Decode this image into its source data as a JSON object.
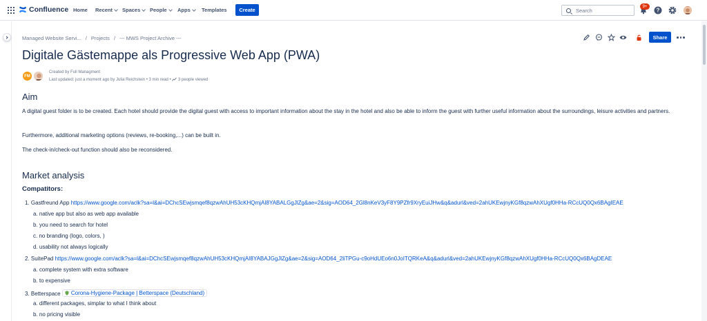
{
  "nav": {
    "logo": "Confluence",
    "home": "Home",
    "recent": "Recent",
    "spaces": "Spaces",
    "people": "People",
    "apps": "Apps",
    "templates": "Templates",
    "create": "Create",
    "search_placeholder": "Search",
    "notification_count": "9+"
  },
  "breadcrumb": [
    "Managed Website Servi...",
    "Projects",
    "--- MWS Project Archive ---"
  ],
  "page_actions": {
    "share": "Share"
  },
  "title": "Digitale Gästemappe als Progressive Web App (PWA)",
  "byline": {
    "initials": "FM",
    "created": "Created by Full Managment",
    "updated": "Last updated: just a moment ago by Julia Reichstein",
    "read_time": "3 min read",
    "viewed": "3 people viewed"
  },
  "content": {
    "aim_heading": "Aim",
    "aim_p1": "A digital guest folder is to be created. Each hotel should provide the digital guest with access to important information about the stay in the hotel and also be able to inform the guest with further useful information about the surroundings, leisure activities and partners.",
    "aim_p2": "Furthermore, additional marketing options (reviews, re-booking,...) can be built in.",
    "aim_p3": "The check-in/check-out function should also be reconsidered.",
    "market_heading": "Market analysis",
    "competitors_heading": "Compatitors:",
    "items": [
      {
        "num": "1.",
        "name": "Gastfreund App",
        "link": "https://www.google.com/aclk?sa=l&ai=DChcSEwjsmqef8qzwAhUH53cKHQmjAI8YABALGgJlZg&ae=2&sig=AOD64_2Gl8nKeV3yF8Y9PZfr9XryEuiJHw&q&adurl&ved=2ahUKEwjnyKGf8qzwAhXUgf0HHa-RCcUQ0Qx6BAgIEAE",
        "subs": [
          {
            "mark": "a.",
            "text": "native app but also as web app available"
          },
          {
            "mark": "b.",
            "text": "you need to search for hotel"
          },
          {
            "mark": "c.",
            "text": "no branding (logo, colors, )"
          },
          {
            "mark": "d.",
            "text": "usability not always logically"
          }
        ]
      },
      {
        "num": "2.",
        "name": "SuitePad",
        "link": "https://www.google.com/aclk?sa=l&ai=DChcSEwjsmqef8qzwAhUH53cKHQmjAI8YABAJGgJlZg&ae=2&sig=AOD64_2liTPGu-c9oHdUEo6n0JoITQRKeA&q&adurl&ved=2ahUKEwjnyKGf8qzwAhXUgf0HHa-RCcUQ0Qx6BAgDEAE",
        "subs": [
          {
            "mark": "a.",
            "text": "complete system with extra software"
          },
          {
            "mark": "b.",
            "text": "to expensive"
          }
        ]
      },
      {
        "num": "3.",
        "name": "Betterspace",
        "smartlink": "Corona-Hygiene-Package | Betterspace (Deutschland)",
        "subs": [
          {
            "mark": "a.",
            "text": "different packages, simplar to what I think about"
          },
          {
            "mark": "b.",
            "text": "no pricing visible"
          }
        ]
      }
    ]
  },
  "colors": {
    "brand": "#0052cc",
    "badge": "#de350b",
    "text": "#172b4d",
    "muted": "#6b778c"
  }
}
